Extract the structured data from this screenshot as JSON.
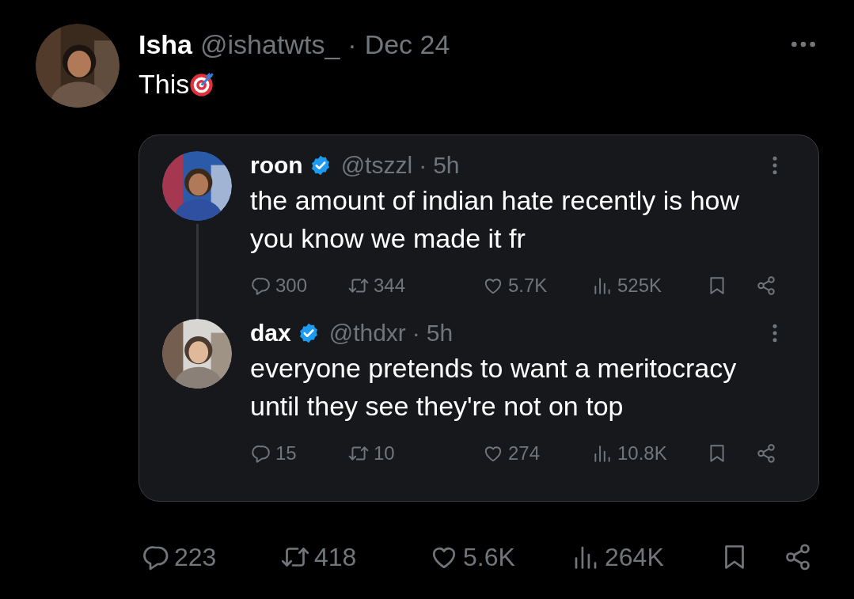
{
  "post": {
    "author": {
      "name": "Isha",
      "handle": "@ishatwts_",
      "separator": "·",
      "time": "Dec 24"
    },
    "text": "This",
    "quoted_thread": [
      {
        "name": "roon",
        "verified": true,
        "handle": "@tszzl",
        "separator": "·",
        "time": "5h",
        "text": "the amount of indian hate recently is how you know we made it fr",
        "stats": {
          "replies": "300",
          "reposts": "344",
          "likes": "5.7K",
          "views": "525K"
        }
      },
      {
        "name": "dax",
        "verified": true,
        "handle": "@thdxr",
        "separator": "·",
        "time": "5h",
        "text": "everyone pretends to want a meritocracy until they see they're not on top",
        "stats": {
          "replies": "15",
          "reposts": "10",
          "likes": "274",
          "views": "10.8K"
        }
      }
    ],
    "stats": {
      "replies": "223",
      "reposts": "418",
      "likes": "5.6K",
      "views": "264K"
    }
  }
}
